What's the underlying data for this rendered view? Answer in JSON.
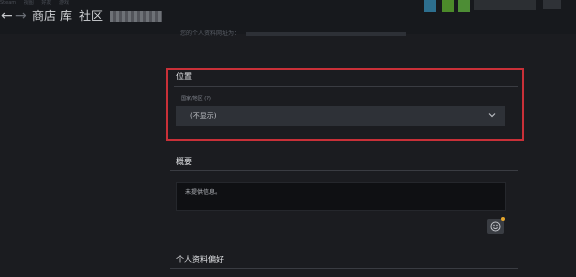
{
  "topbar": {
    "menu_items": [
      "Steam",
      "视图",
      "好友",
      "游戏"
    ],
    "back_glyph": "←",
    "forward_glyph": "→",
    "nav": {
      "store": "商店",
      "library": "库",
      "community": "社区"
    }
  },
  "profile": {
    "blurred_hint": "您的个人资料网址为：",
    "location": {
      "heading": "位置",
      "field_label": "国家/地区 (?)",
      "selected": "(不显示)"
    },
    "summary": {
      "heading": "概要",
      "text": "未提供信息。"
    },
    "preferences": {
      "heading": "个人资料偏好"
    }
  },
  "icons": {
    "back": "arrow-left-icon",
    "forward": "arrow-right-icon",
    "dropdown": "chevron-down-icon",
    "emoticon": "emoticon-icon"
  },
  "colors": {
    "background": "#1b1c20",
    "highlight_border": "#c93038",
    "select_bg": "#2e3137",
    "textarea_bg": "#0f1013"
  }
}
